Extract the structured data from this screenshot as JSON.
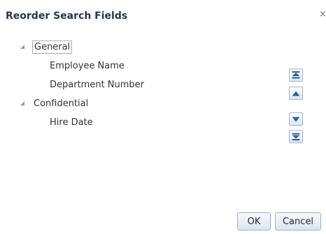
{
  "dialog": {
    "title": "Reorder Search Fields",
    "close_glyph": "×",
    "close_icon": "close-icon"
  },
  "tree": {
    "groups": [
      {
        "label": "General",
        "expanded": true,
        "items": [
          "Employee Name",
          "Department Number"
        ]
      },
      {
        "label": "Confidential",
        "expanded": true,
        "items": [
          "Hire Date"
        ]
      }
    ]
  },
  "move_buttons": [
    {
      "name": "move-to-top-button",
      "icon": "double-chevron-up-icon"
    },
    {
      "name": "move-up-button",
      "icon": "chevron-up-icon"
    },
    {
      "name": "move-down-button",
      "icon": "chevron-down-icon"
    },
    {
      "name": "move-to-bottom-button",
      "icon": "double-chevron-down-icon"
    }
  ],
  "buttons": {
    "ok_label": "OK",
    "cancel_label": "Cancel"
  },
  "colors": {
    "title": "#21384f",
    "button_border": "#9cb1c9",
    "arrow_fill": "#2a5f9e"
  }
}
